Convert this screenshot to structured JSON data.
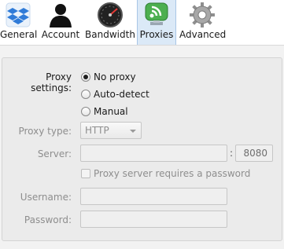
{
  "toolbar": {
    "tabs": [
      {
        "label": "General",
        "icon": "dropbox-icon",
        "active": false
      },
      {
        "label": "Account",
        "icon": "user-silhouette-icon",
        "active": false
      },
      {
        "label": "Bandwidth",
        "icon": "speedometer-icon",
        "active": false
      },
      {
        "label": "Proxies",
        "icon": "wifi-monitor-icon",
        "active": true
      },
      {
        "label": "Advanced",
        "icon": "gear-icon",
        "active": false
      }
    ]
  },
  "proxy": {
    "settings_label": "Proxy settings:",
    "options": [
      {
        "label": "No proxy",
        "checked": true
      },
      {
        "label": "Auto-detect",
        "checked": false
      },
      {
        "label": "Manual",
        "checked": false
      }
    ],
    "type_label": "Proxy type:",
    "type_value": "HTTP",
    "server_label": "Server:",
    "server_value": "",
    "port_separator": ":",
    "port_value": "8080",
    "auth_checkbox_label": "Proxy server requires a password",
    "username_label": "Username:",
    "username_value": "",
    "password_label": "Password:",
    "password_value": ""
  },
  "colors": {
    "active_tab_bg": "#dbe9f7",
    "disabled_text": "#8e8e8e",
    "proxies_icon_green": "#4caf50"
  }
}
